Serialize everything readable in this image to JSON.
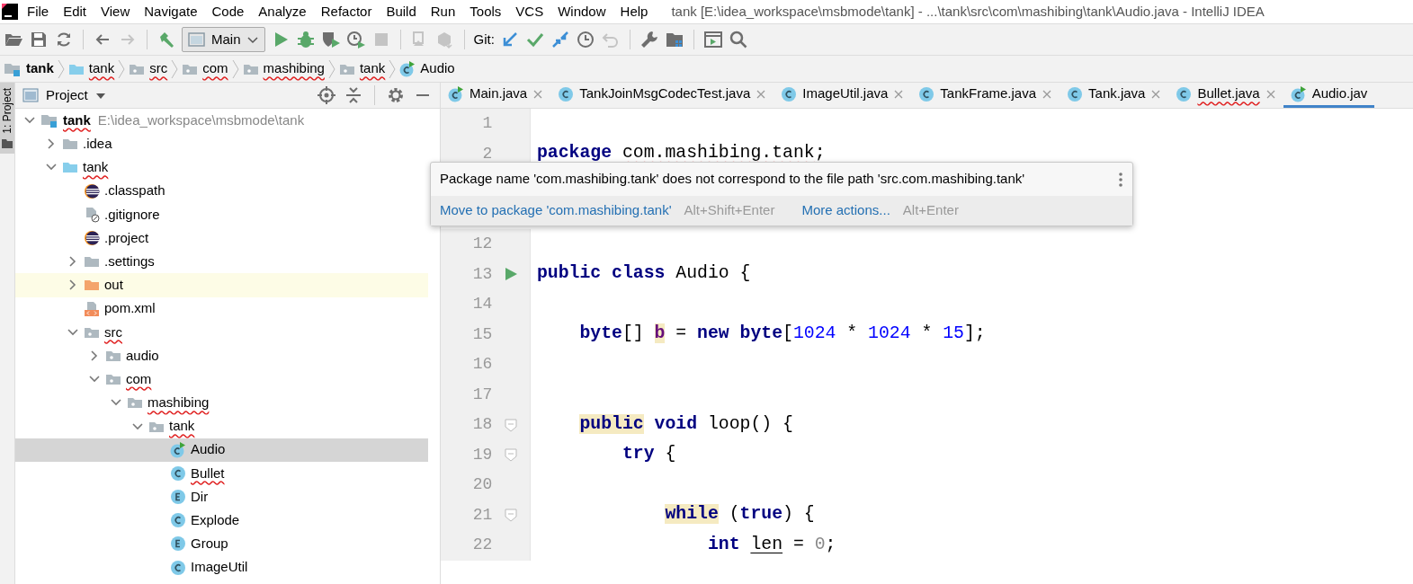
{
  "window": {
    "title": "tank [E:\\idea_workspace\\msbmode\\tank] - ...\\tank\\src\\com\\mashibing\\tank\\Audio.java - IntelliJ IDEA"
  },
  "menu": [
    {
      "label": "File"
    },
    {
      "label": "Edit"
    },
    {
      "label": "View"
    },
    {
      "label": "Navigate"
    },
    {
      "label": "Code"
    },
    {
      "label": "Analyze"
    },
    {
      "label": "Refactor"
    },
    {
      "label": "Build"
    },
    {
      "label": "Run"
    },
    {
      "label": "Tools"
    },
    {
      "label": "VCS"
    },
    {
      "label": "Window"
    },
    {
      "label": "Help"
    }
  ],
  "toolbar": {
    "run_config": "Main",
    "git_label": "Git:"
  },
  "breadcrumbs": [
    {
      "label": "tank",
      "kind": "module",
      "typo": false
    },
    {
      "label": "tank",
      "kind": "folder-blue",
      "typo": true
    },
    {
      "label": "src",
      "kind": "package",
      "typo": true
    },
    {
      "label": "com",
      "kind": "package",
      "typo": true
    },
    {
      "label": "mashibing",
      "kind": "package",
      "typo": true
    },
    {
      "label": "tank",
      "kind": "package",
      "typo": true
    },
    {
      "label": "Audio",
      "kind": "class-run",
      "typo": false
    }
  ],
  "side_strip": {
    "label": "1: Project"
  },
  "project_panel": {
    "title": "Project",
    "tree": [
      {
        "label": "tank",
        "kind": "module",
        "hint": "E:\\idea_workspace\\msbmode\\tank",
        "typo": true,
        "selected": false,
        "expanded": true,
        "children": [
          {
            "label": ".idea",
            "kind": "folder",
            "typo": false,
            "selected": false,
            "expanded": false
          },
          {
            "label": "tank",
            "kind": "folder-blue",
            "typo": true,
            "selected": false,
            "expanded": true,
            "children": [
              {
                "label": ".classpath",
                "kind": "eclipse",
                "typo": false,
                "selected": false
              },
              {
                "label": ".gitignore",
                "kind": "ignore-file",
                "typo": false,
                "selected": false
              },
              {
                "label": ".project",
                "kind": "eclipse",
                "typo": false,
                "selected": false
              },
              {
                "label": ".settings",
                "kind": "folder",
                "typo": false,
                "selected": false,
                "expanded": false
              },
              {
                "label": "out",
                "kind": "excluded",
                "typo": false,
                "selected": false,
                "expanded": false
              },
              {
                "label": "pom.xml",
                "kind": "xml",
                "typo": false,
                "selected": false
              },
              {
                "label": "src",
                "kind": "package",
                "typo": true,
                "selected": false,
                "expanded": true,
                "children": [
                  {
                    "label": "audio",
                    "kind": "package",
                    "typo": false,
                    "selected": false,
                    "expanded": false
                  },
                  {
                    "label": "com",
                    "kind": "package",
                    "typo": true,
                    "selected": false,
                    "expanded": true,
                    "children": [
                      {
                        "label": "mashibing",
                        "kind": "package",
                        "typo": true,
                        "selected": false,
                        "expanded": true,
                        "children": [
                          {
                            "label": "tank",
                            "kind": "package",
                            "typo": true,
                            "selected": false,
                            "expanded": true,
                            "children": [
                              {
                                "label": "Audio",
                                "kind": "class-run",
                                "typo": false,
                                "selected": true
                              },
                              {
                                "label": "Bullet",
                                "kind": "class",
                                "typo": true,
                                "selected": false
                              },
                              {
                                "label": "Dir",
                                "kind": "enum",
                                "typo": false,
                                "selected": false
                              },
                              {
                                "label": "Explode",
                                "kind": "class",
                                "typo": false,
                                "selected": false
                              },
                              {
                                "label": "Group",
                                "kind": "enum",
                                "typo": false,
                                "selected": false
                              },
                              {
                                "label": "ImageUtil",
                                "kind": "class",
                                "typo": false,
                                "selected": false
                              }
                            ]
                          }
                        ]
                      }
                    ]
                  }
                ]
              }
            ]
          }
        ]
      }
    ]
  },
  "tabs": [
    {
      "label": "Main.java",
      "kind": "class-run",
      "typo": false,
      "selected": false
    },
    {
      "label": "TankJoinMsgCodecTest.java",
      "kind": "class",
      "typo": false,
      "selected": false
    },
    {
      "label": "ImageUtil.java",
      "kind": "class",
      "typo": false,
      "selected": false
    },
    {
      "label": "TankFrame.java",
      "kind": "class",
      "typo": false,
      "selected": false
    },
    {
      "label": "Tank.java",
      "kind": "class",
      "typo": false,
      "selected": false
    },
    {
      "label": "Bullet.java",
      "kind": "class",
      "typo": true,
      "selected": false
    },
    {
      "label": "Audio.jav",
      "kind": "class-run",
      "typo": false,
      "selected": true
    }
  ],
  "editor": [
    {
      "kind": "line",
      "number": "1"
    },
    {
      "kind": "line",
      "number": "2",
      "tokens": [
        {
          "kind": "keyword",
          "text": "package "
        },
        {
          "kind": "error",
          "text": "com.mashibing.tank"
        },
        {
          "kind": "plain",
          "text": ";"
        }
      ]
    },
    {
      "kind": "popup",
      "message": "Package name 'com.mashibing.tank' does not correspond to the file path 'src.com.mashibing.tank'",
      "actions": [
        {
          "label": "Move to package 'com.mashibing.tank'",
          "shortcut": "Alt+Shift+Enter"
        },
        {
          "label": "More actions...",
          "shortcut": "Alt+Enter"
        }
      ]
    },
    {
      "kind": "line",
      "number": "12"
    },
    {
      "kind": "run-line",
      "number": "13",
      "tokens": [
        {
          "kind": "keyword",
          "text": "public class "
        },
        {
          "kind": "plain",
          "text": "Audio {"
        }
      ]
    },
    {
      "kind": "line",
      "number": "14"
    },
    {
      "kind": "line",
      "number": "15",
      "tokens": [
        {
          "kind": "keyword",
          "text": "    byte"
        },
        {
          "kind": "plain",
          "text": "[] "
        },
        {
          "kind": "field-marked",
          "text": "b"
        },
        {
          "kind": "plain",
          "text": " = "
        },
        {
          "kind": "keyword",
          "text": "new byte"
        },
        {
          "kind": "plain",
          "text": "["
        },
        {
          "kind": "number",
          "text": "1024"
        },
        {
          "kind": "plain",
          "text": " * "
        },
        {
          "kind": "number",
          "text": "1024"
        },
        {
          "kind": "plain",
          "text": " * "
        },
        {
          "kind": "number",
          "text": "15"
        },
        {
          "kind": "plain",
          "text": "];"
        }
      ]
    },
    {
      "kind": "line",
      "number": "16"
    },
    {
      "kind": "line",
      "number": "17"
    },
    {
      "kind": "fold-line",
      "number": "18",
      "tokens": [
        {
          "kind": "keyword-marked",
          "text": "    public"
        },
        {
          "kind": "keyword",
          "text": " void"
        },
        {
          "kind": "plain",
          "text": " loop() {"
        }
      ]
    },
    {
      "kind": "fold-line",
      "number": "19",
      "tokens": [
        {
          "kind": "keyword",
          "text": "        try"
        },
        {
          "kind": "plain",
          "text": " {"
        }
      ]
    },
    {
      "kind": "line",
      "number": "20"
    },
    {
      "kind": "fold-line",
      "number": "21",
      "tokens": [
        {
          "kind": "keyword-marked",
          "text": "            while"
        },
        {
          "kind": "plain",
          "text": " ("
        },
        {
          "kind": "keyword",
          "text": "true"
        },
        {
          "kind": "plain",
          "text": ") {"
        }
      ]
    },
    {
      "kind": "line",
      "number": "22",
      "tokens": [
        {
          "kind": "keyword",
          "text": "                int "
        },
        {
          "kind": "underlined",
          "text": "len"
        },
        {
          "kind": "plain",
          "text": " = "
        },
        {
          "kind": "muted",
          "text": "0"
        },
        {
          "kind": "plain",
          "text": ";"
        }
      ]
    }
  ]
}
